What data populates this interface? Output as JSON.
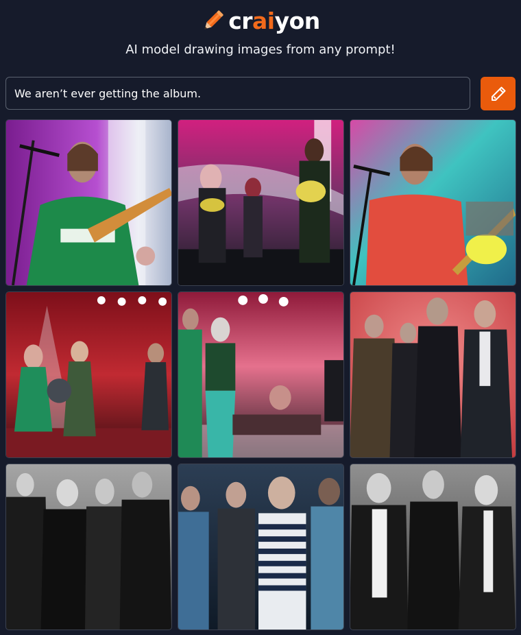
{
  "brand": {
    "name_part1": "cr",
    "name_accent": "ai",
    "name_part2": "yon",
    "accent_color": "#f26a1b"
  },
  "tagline": "AI model drawing images from any prompt!",
  "prompt": {
    "value": "We aren’t ever getting the album.",
    "placeholder": ""
  },
  "draw_button": {
    "icon": "pencil-icon",
    "color": "#ea5b0c"
  },
  "results": {
    "count": 9,
    "images": [
      {
        "subject": "singer-guitarist-green-shirt",
        "palette": "purple-stage"
      },
      {
        "subject": "band-on-stage",
        "palette": "magenta-stage"
      },
      {
        "subject": "singer-red-shirt",
        "palette": "teal-magenta-stage"
      },
      {
        "subject": "band-red-stage",
        "palette": "red-stage"
      },
      {
        "subject": "band-pink-stage",
        "palette": "pink-stage"
      },
      {
        "subject": "band-portrait",
        "palette": "red-backdrop"
      },
      {
        "subject": "band-portrait",
        "palette": "black-and-white"
      },
      {
        "subject": "band-portrait",
        "palette": "blue-dark"
      },
      {
        "subject": "band-portrait",
        "palette": "black-and-white"
      }
    ]
  }
}
